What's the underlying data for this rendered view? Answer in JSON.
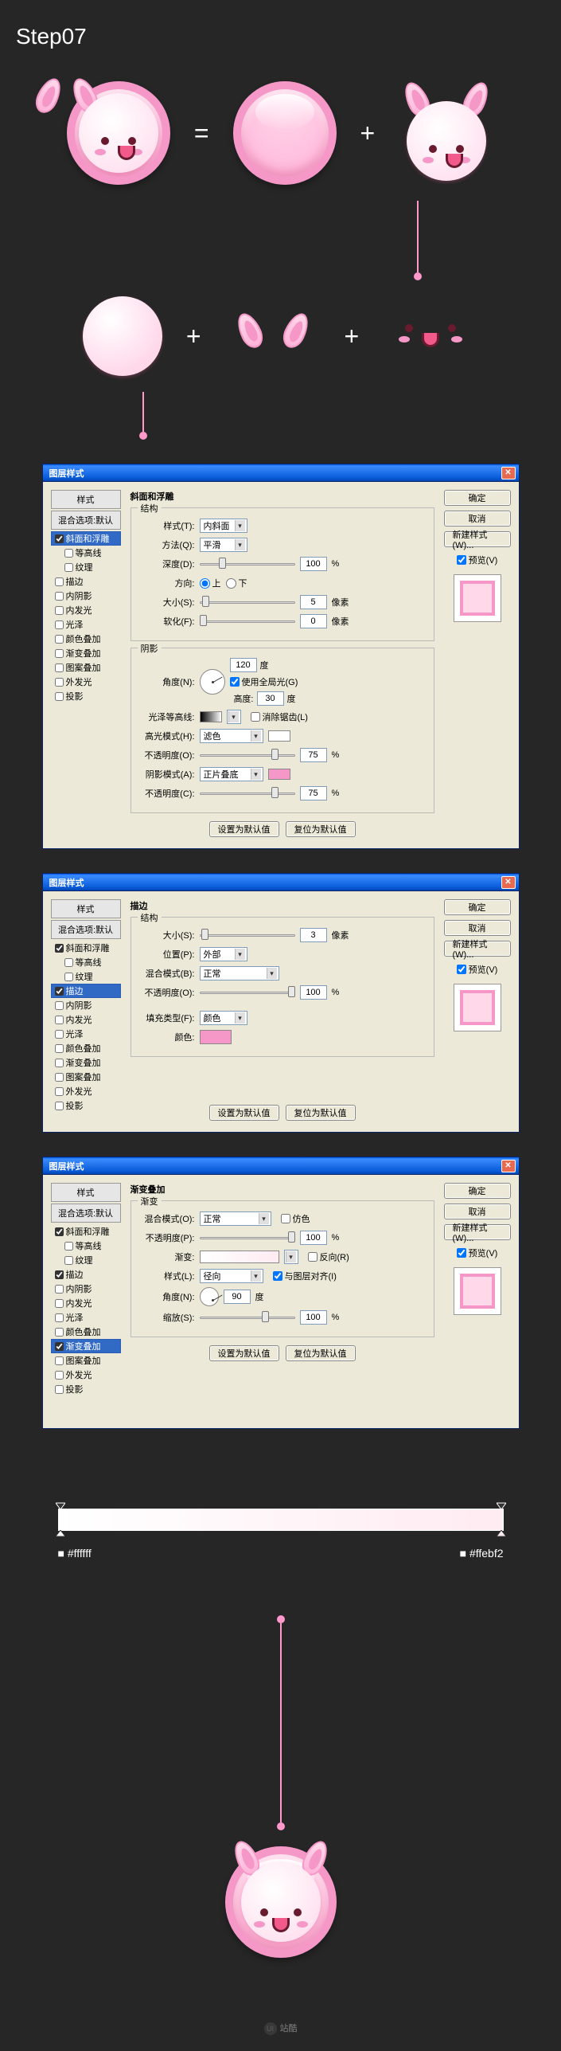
{
  "step_title": "Step07",
  "operators": {
    "equals": "=",
    "plus": "+"
  },
  "sidebar_common": {
    "head1": "样式",
    "blend_default": "混合选项:默认",
    "bevel": "斜面和浮雕",
    "contour": "等高线",
    "texture": "纹理",
    "stroke": "描边",
    "inner_shadow": "内阴影",
    "inner_glow": "内发光",
    "gloss": "光泽",
    "color_overlay": "颜色叠加",
    "grad_overlay": "渐变叠加",
    "pattern_overlay": "图案叠加",
    "outer_glow": "外发光",
    "drop_shadow": "投影"
  },
  "dialog1": {
    "title": "图层样式",
    "section_title": "斜面和浮雕",
    "structure": "结构",
    "style_lbl": "样式(T):",
    "style_val": "内斜面",
    "method_lbl": "方法(Q):",
    "method_val": "平滑",
    "depth_lbl": "深度(D):",
    "depth_val": "100",
    "depth_unit": "%",
    "dir_lbl": "方向:",
    "dir_up": "上",
    "dir_down": "下",
    "size_lbl": "大小(S):",
    "size_val": "5",
    "size_unit": "像素",
    "soften_lbl": "软化(F):",
    "soften_val": "0",
    "soften_unit": "像素",
    "shading": "阴影",
    "angle_lbl": "角度(N):",
    "angle_val": "120",
    "angle_unit": "度",
    "global_light": "使用全局光(G)",
    "altitude_lbl": "高度:",
    "altitude_val": "30",
    "altitude_unit": "度",
    "gloss_contour_lbl": "光泽等高线:",
    "anti_alias": "消除锯齿(L)",
    "hilite_mode_lbl": "高光模式(H):",
    "hilite_mode_val": "滤色",
    "opacity_hilite_lbl": "不透明度(O):",
    "opacity_hilite_val": "75",
    "shadow_mode_lbl": "阴影模式(A):",
    "shadow_mode_val": "正片叠底",
    "opacity_shadow_lbl": "不透明度(C):",
    "opacity_shadow_val": "75",
    "pct": "%",
    "default_btn": "设置为默认值",
    "reset_btn": "复位为默认值"
  },
  "dialog2": {
    "title": "图层样式",
    "section_title": "描边",
    "structure": "结构",
    "size_lbl": "大小(S):",
    "size_val": "3",
    "size_unit": "像素",
    "pos_lbl": "位置(P):",
    "pos_val": "外部",
    "blend_lbl": "混合模式(B):",
    "blend_val": "正常",
    "opacity_lbl": "不透明度(O):",
    "opacity_val": "100",
    "pct": "%",
    "fill_type_lbl": "填充类型(F):",
    "fill_type_val": "颜色",
    "color_lbl": "颜色:",
    "stroke_color": "#f598c8",
    "default_btn": "设置为默认值",
    "reset_btn": "复位为默认值"
  },
  "dialog3": {
    "title": "图层样式",
    "section_title": "渐变叠加",
    "gradient": "渐变",
    "blend_lbl": "混合模式(O):",
    "blend_val": "正常",
    "dither": "仿色",
    "opacity_lbl": "不透明度(P):",
    "opacity_val": "100",
    "pct": "%",
    "grad_lbl": "渐变:",
    "reverse": "反向(R)",
    "style_lbl": "样式(L):",
    "style_val": "径向",
    "align": "与图层对齐(I)",
    "angle_lbl": "角度(N):",
    "angle_val": "90",
    "angle_unit": "度",
    "scale_lbl": "缩放(S):",
    "scale_val": "100",
    "default_btn": "设置为默认值",
    "reset_btn": "复位为默认值"
  },
  "right_buttons": {
    "ok": "确定",
    "cancel": "取消",
    "new_style": "新建样式(W)...",
    "preview": "预览(V)"
  },
  "gradient_stops": {
    "left": "#ffffff",
    "right": "#ffebf2"
  },
  "gradient": {
    "start": "#ffffff",
    "end": "#ffebf2"
  },
  "watermark": "站酷"
}
